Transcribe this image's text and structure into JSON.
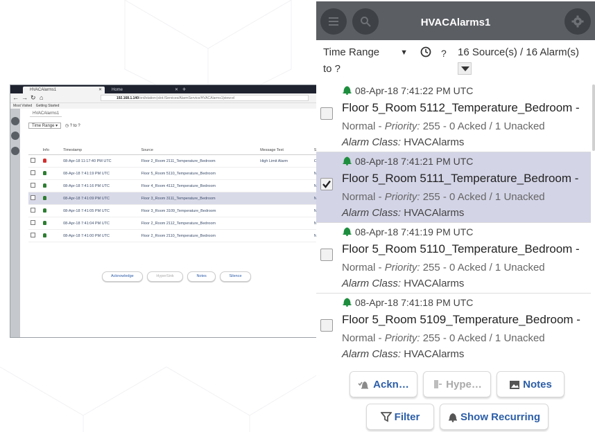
{
  "desktop": {
    "tabs": [
      {
        "label": "HVACAlarms1"
      },
      {
        "label": "Home"
      }
    ],
    "url_host": "192.168.1.140",
    "url_path": "/ord/station:|slot:/Services/AlarmService/HVACAlarms1|view:el",
    "bookmarks": [
      "Most Visited",
      "Getting Started"
    ],
    "panel_title": "HVACAlarms1",
    "time_range_label": "Time Range",
    "time_to": "? to ?",
    "columns": [
      "Info",
      "Timestamp",
      "Source",
      "Message Text",
      "So"
    ],
    "rows": [
      {
        "bell_color": "#d32f2f",
        "timestamp": "08-Apr-18 11:17:40 PM UTC",
        "source": "Floor 2_Room 2111_Temperature_Bedroom",
        "message": "High Limit Alarm",
        "so": "Off",
        "checked": false
      },
      {
        "bell_color": "#2e7d32",
        "timestamp": "08-Apr-18 7:41:19 PM UTC",
        "source": "Floor 5_Room 5110_Temperature_Bedroom",
        "message": "",
        "so": "No",
        "checked": false
      },
      {
        "bell_color": "#2e7d32",
        "timestamp": "08-Apr-18 7:41:16 PM UTC",
        "source": "Floor 4_Room 4112_Temperature_Bedroom",
        "message": "",
        "so": "No",
        "checked": false
      },
      {
        "bell_color": "#2e7d32",
        "timestamp": "08-Apr-18 7:41:09 PM UTC",
        "source": "Floor 3_Room 3111_Temperature_Bedroom",
        "message": "",
        "so": "No",
        "checked": true
      },
      {
        "bell_color": "#2e7d32",
        "timestamp": "08-Apr-18 7:41:05 PM UTC",
        "source": "Floor 3_Room 3109_Temperature_Bedroom",
        "message": "",
        "so": "No",
        "checked": false
      },
      {
        "bell_color": "#2e7d32",
        "timestamp": "08-Apr-18 7:41:04 PM UTC",
        "source": "Floor 2_Room 2112_Temperature_Bedroom",
        "message": "",
        "so": "No",
        "checked": false
      },
      {
        "bell_color": "#2e7d32",
        "timestamp": "08-Apr-18 7:41:00 PM UTC",
        "source": "Floor 2_Room 2110_Temperature_Bedroom",
        "message": "",
        "so": "No",
        "checked": false
      }
    ],
    "buttons": [
      "Acknowledge",
      "HyperSink",
      "Notes",
      "Silence"
    ]
  },
  "mobile": {
    "title": "HVACAlarms1",
    "header_icons": [
      "menu-icon",
      "search-icon",
      "settings-icon"
    ],
    "time_range": "Time Range",
    "time_to": "to ?",
    "question": "?",
    "count": "16 Source(s) / 16 Alarm(s)",
    "accent_color": "#2c5ea8",
    "bell_color": "#1e8e3e",
    "alarms": [
      {
        "time": "08-Apr-18 7:41:22 PM UTC",
        "source": "Floor 5_Room 5112_Temperature_Bedroom -",
        "state": "Normal",
        "priority_label": "Priority:",
        "priority_rest": "255 - 0 Acked / 1 Unacked",
        "class_label": "Alarm Class:",
        "class_value": "HVACAlarms",
        "selected": false
      },
      {
        "time": "08-Apr-18 7:41:21 PM UTC",
        "source": "Floor 5_Room 5111_Temperature_Bedroom -",
        "state": "Normal",
        "priority_label": "Priority:",
        "priority_rest": "255 - 0 Acked / 1 Unacked",
        "class_label": "Alarm Class:",
        "class_value": "HVACAlarms",
        "selected": true
      },
      {
        "time": "08-Apr-18 7:41:19 PM UTC",
        "source": "Floor 5_Room 5110_Temperature_Bedroom -",
        "state": "Normal",
        "priority_label": "Priority:",
        "priority_rest": "255 - 0 Acked / 1 Unacked",
        "class_label": "Alarm Class:",
        "class_value": "HVACAlarms",
        "selected": false
      },
      {
        "time": "08-Apr-18 7:41:18 PM UTC",
        "source": "Floor 5_Room 5109_Temperature_Bedroom -",
        "state": "Normal",
        "priority_label": "Priority:",
        "priority_rest": "255 - 0 Acked / 1 Unacked",
        "class_label": "Alarm Class:",
        "class_value": "HVACAlarms",
        "selected": false
      }
    ],
    "actions": {
      "acknowledge": "Ackn…",
      "hyperlink": "Hype…",
      "notes": "Notes",
      "filter": "Filter",
      "show_recurring": "Show Recurring"
    }
  }
}
